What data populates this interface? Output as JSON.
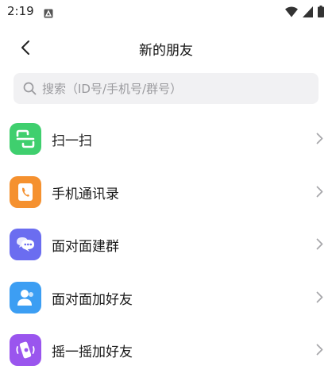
{
  "status_bar": {
    "time": "2:19"
  },
  "header": {
    "title": "新的朋友"
  },
  "search": {
    "placeholder": "搜索（ID号/手机号/群号）"
  },
  "items": [
    {
      "label": "扫一扫",
      "icon": "scan-icon",
      "color": "#3fcf6e"
    },
    {
      "label": "手机通讯录",
      "icon": "phone-contacts-icon",
      "color": "#f5912f"
    },
    {
      "label": "面对面建群",
      "icon": "chat-group-icon",
      "color": "#6b6df0"
    },
    {
      "label": "面对面加好友",
      "icon": "add-friend-icon",
      "color": "#3c9ef3"
    },
    {
      "label": "摇一摇加好友",
      "icon": "shake-icon",
      "color": "#9a55ee"
    }
  ]
}
